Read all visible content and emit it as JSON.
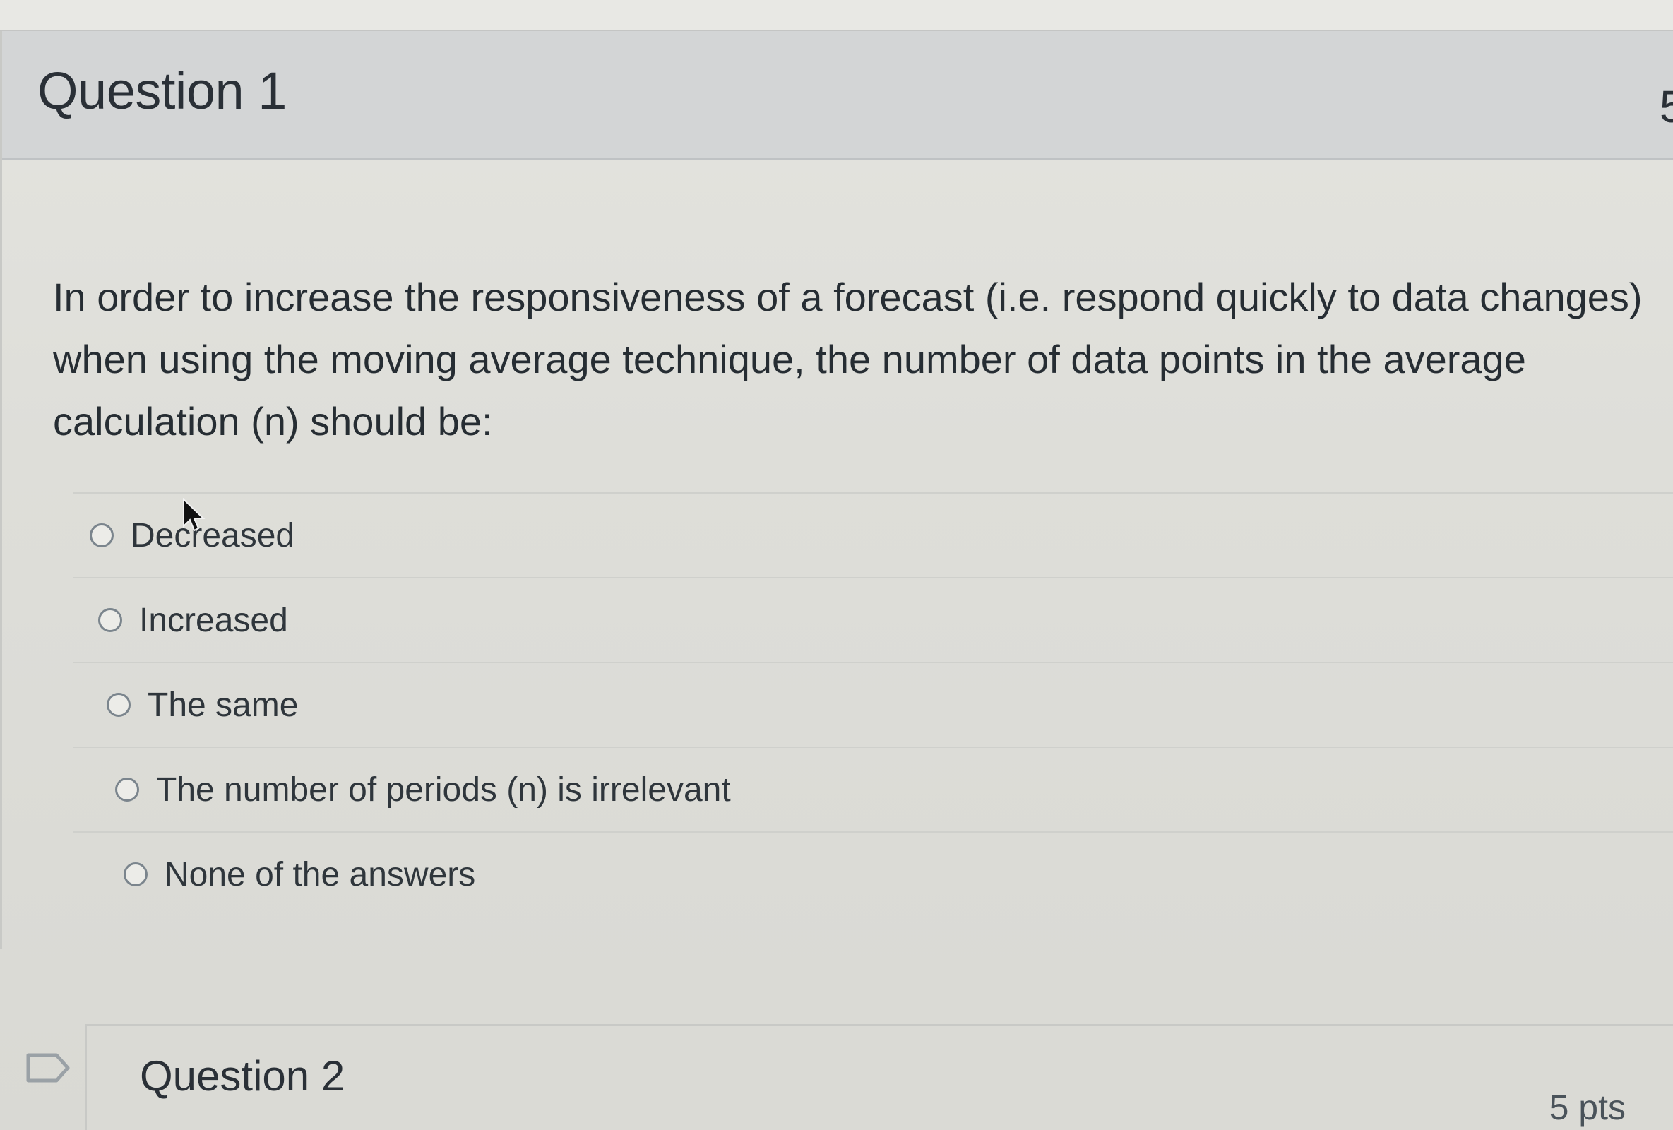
{
  "question1": {
    "title": "Question 1",
    "points_partial": "5",
    "text": "In order to increase the responsiveness of a forecast (i.e. respond quickly to data changes) when using the moving average technique, the number of data points in the average calculation (n) should be:",
    "answers": [
      {
        "label": "Decreased"
      },
      {
        "label": "Increased"
      },
      {
        "label": "The same"
      },
      {
        "label": "The number of periods (n) is irrelevant"
      },
      {
        "label": "None of the answers"
      }
    ]
  },
  "question2": {
    "title": "Question 2",
    "points": "5 pts"
  },
  "icons": {
    "flag": "flag-question-icon",
    "cursor": "mouse-cursor-icon",
    "radio": "radio-button-icon"
  }
}
